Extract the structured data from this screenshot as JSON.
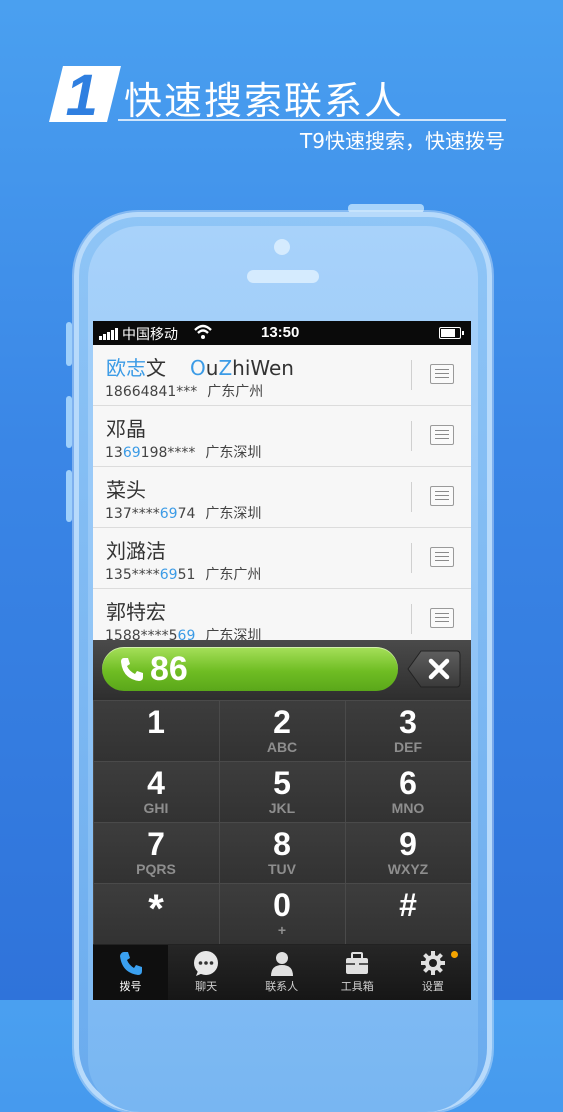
{
  "header": {
    "number": "1",
    "title": "快速搜索联系人",
    "subtitle": "T9快速搜索，快速拨号"
  },
  "status_bar": {
    "carrier": "中国移动",
    "time": "13:50"
  },
  "contacts": [
    {
      "name_hl": "欧志",
      "name_rest": "文",
      "pinyin_parts": [
        [
          "O",
          "hl"
        ],
        [
          "u",
          ""
        ],
        [
          "Z",
          "hl"
        ],
        [
          "hiWen",
          ""
        ]
      ],
      "phone_parts": [
        [
          "18664841***",
          ""
        ]
      ],
      "location": "广东广州"
    },
    {
      "name_hl": "",
      "name_rest": "邓晶",
      "phone_parts": [
        [
          "13",
          ""
        ],
        [
          "69",
          "hl"
        ],
        [
          "198****",
          ""
        ]
      ],
      "location": "广东深圳"
    },
    {
      "name_hl": "",
      "name_rest": "菜头",
      "phone_parts": [
        [
          "137****",
          ""
        ],
        [
          "69",
          "hl"
        ],
        [
          "74",
          ""
        ]
      ],
      "location": "广东深圳"
    },
    {
      "name_hl": "",
      "name_rest": "刘潞洁",
      "phone_parts": [
        [
          "135****",
          ""
        ],
        [
          "69",
          "hl"
        ],
        [
          "51",
          ""
        ]
      ],
      "location": "广东广州"
    },
    {
      "name_hl": "",
      "name_rest": "郭特宏",
      "phone_parts": [
        [
          "1588****5",
          ""
        ],
        [
          "69",
          "hl"
        ],
        [
          "",
          ""
        ]
      ],
      "location": "广东深圳"
    }
  ],
  "dial": {
    "input": "86"
  },
  "keypad": [
    {
      "num": "1",
      "letters": ""
    },
    {
      "num": "2",
      "letters": "ABC"
    },
    {
      "num": "3",
      "letters": "DEF"
    },
    {
      "num": "4",
      "letters": "GHI"
    },
    {
      "num": "5",
      "letters": "JKL"
    },
    {
      "num": "6",
      "letters": "MNO"
    },
    {
      "num": "7",
      "letters": "PQRS"
    },
    {
      "num": "8",
      "letters": "TUV"
    },
    {
      "num": "9",
      "letters": "WXYZ"
    },
    {
      "num": "*",
      "letters": ""
    },
    {
      "num": "0",
      "letters": "+"
    },
    {
      "num": "#",
      "letters": ""
    }
  ],
  "tabs": [
    {
      "label": "拨号",
      "icon": "dial-icon",
      "active": true
    },
    {
      "label": "聊天",
      "icon": "chat-icon",
      "active": false
    },
    {
      "label": "联系人",
      "icon": "contact-icon",
      "active": false
    },
    {
      "label": "工具箱",
      "icon": "toolbox-icon",
      "active": false
    },
    {
      "label": "设置",
      "icon": "gear-icon",
      "active": false
    }
  ],
  "colors": {
    "background": "#3a86e6",
    "highlight": "#3b9be6",
    "call_green": "#6fbd23",
    "notify_dot": "#f5a400"
  }
}
